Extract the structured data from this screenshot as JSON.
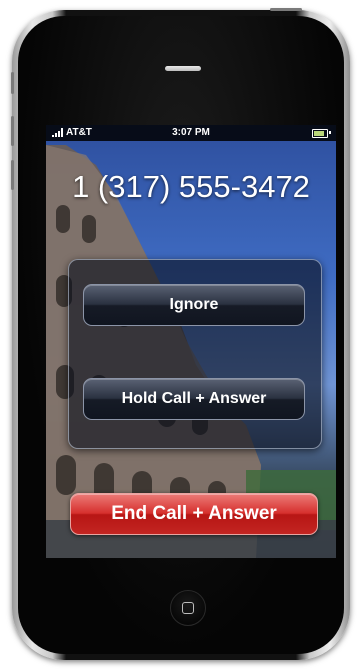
{
  "status_bar": {
    "carrier": "AT&T",
    "time": "3:07 PM",
    "signal_icon": "signal-bars-icon",
    "battery_icon": "battery-icon"
  },
  "incoming_call": {
    "caller_number": "1 (317) 555-3472"
  },
  "dialog": {
    "ignore_label": "Ignore",
    "hold_answer_label": "Hold Call + Answer"
  },
  "end_answer_label": "End Call + Answer",
  "hardware": {
    "home_button_icon": "home-button-icon",
    "speaker_icon": "earpiece-speaker-icon"
  },
  "colors": {
    "end_button": "#d6302d",
    "dialog_button": "#2a3140",
    "status_bar": "#000000"
  }
}
